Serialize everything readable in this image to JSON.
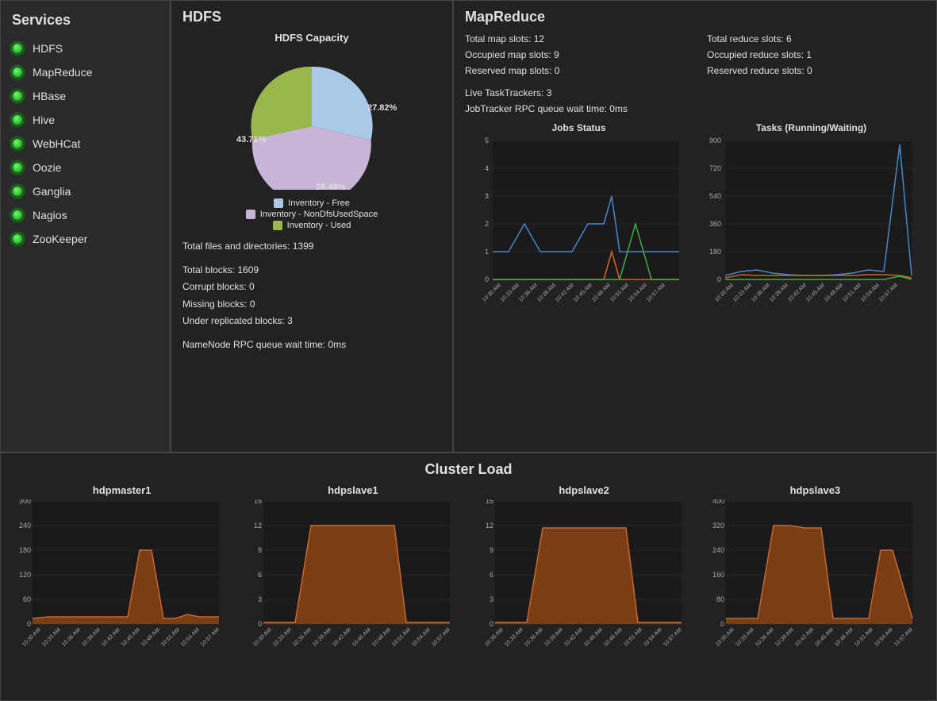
{
  "sidebar": {
    "title": "Services",
    "items": [
      {
        "label": "HDFS"
      },
      {
        "label": "MapReduce"
      },
      {
        "label": "HBase"
      },
      {
        "label": "Hive"
      },
      {
        "label": "WebHCat"
      },
      {
        "label": "Oozie"
      },
      {
        "label": "Ganglia"
      },
      {
        "label": "Nagios"
      },
      {
        "label": "ZooKeeper"
      }
    ]
  },
  "hdfs": {
    "title": "HDFS",
    "chart_title": "HDFS Capacity",
    "pie": {
      "free_pct": "27.82%",
      "nondfs_pct": "43.71%",
      "used_pct": "28.48%"
    },
    "legend": [
      {
        "label": "Inventory - Free",
        "color": "#aac8e8"
      },
      {
        "label": "Inventory - NonDfsUsedSpace",
        "color": "#c8b4d4"
      },
      {
        "label": "Inventory - Used",
        "color": "#9ab84a"
      }
    ],
    "stats": [
      "Total files and directories: 1399",
      "",
      "Total blocks: 1609",
      "Corrupt blocks: 0",
      "Missing blocks: 0",
      "Under replicated blocks: 3",
      "",
      "NameNode RPC queue wait time: 0ms"
    ]
  },
  "mapreduce": {
    "title": "MapReduce",
    "stats_left": [
      "Total map slots: 12",
      "Occupied map slots: 9",
      "Reserved map slots: 0"
    ],
    "stats_right": [
      "Total reduce slots: 6",
      "Occupied reduce slots: 1",
      "Reserved reduce slots: 0"
    ],
    "live_trackers": "Live TaskTrackers: 3",
    "rpc_wait": "JobTracker RPC queue wait time: 0ms",
    "jobs_chart_title": "Jobs Status",
    "tasks_chart_title": "Tasks (Running/Waiting)"
  },
  "cluster": {
    "title": "Cluster Load",
    "hosts": [
      {
        "name": "hdpmaster1",
        "max": 300,
        "ticks": [
          0,
          60,
          120,
          180,
          240,
          300
        ]
      },
      {
        "name": "hdpslave1",
        "max": 15,
        "ticks": [
          0,
          3,
          6,
          9,
          12,
          15
        ]
      },
      {
        "name": "hdpslave2",
        "max": 15,
        "ticks": [
          0,
          3,
          6,
          9,
          12,
          15
        ]
      },
      {
        "name": "hdpslave3",
        "max": 400,
        "ticks": [
          0,
          80,
          160,
          240,
          320,
          400
        ]
      }
    ]
  },
  "time_labels": [
    "10:30 AM",
    "10:33 AM",
    "10:36 AM",
    "10:39 AM",
    "10:42 AM",
    "10:45 AM",
    "10:48 AM",
    "10:51 AM",
    "10:54 AM",
    "10:57 AM"
  ]
}
